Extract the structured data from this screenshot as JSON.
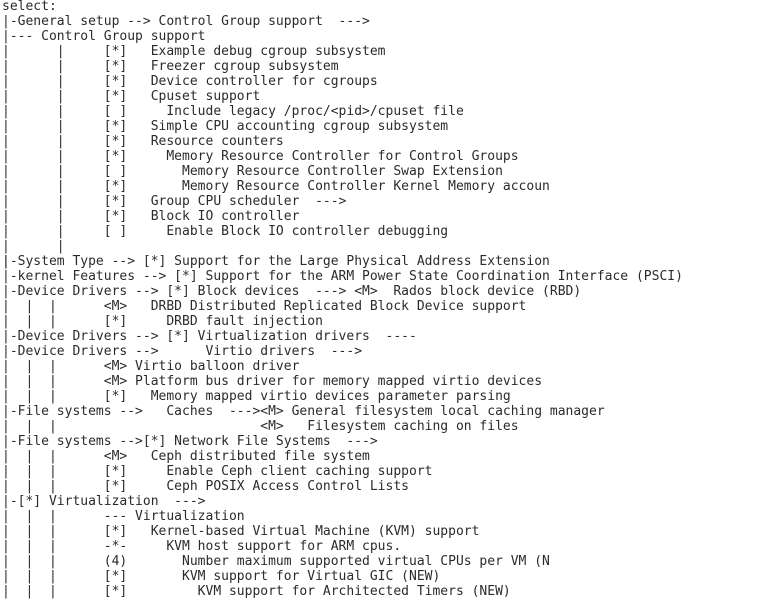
{
  "terminal": {
    "lines": [
      "select:",
      "|-General setup --> Control Group support  --->",
      "|--- Control Group support",
      "|      |     [*]   Example debug cgroup subsystem",
      "|      |     [*]   Freezer cgroup subsystem",
      "|      |     [*]   Device controller for cgroups",
      "|      |     [*]   Cpuset support",
      "|      |     [ ]     Include legacy /proc/<pid>/cpuset file",
      "|      |     [*]   Simple CPU accounting cgroup subsystem",
      "|      |     [*]   Resource counters",
      "|      |     [*]     Memory Resource Controller for Control Groups",
      "|      |     [ ]       Memory Resource Controller Swap Extension",
      "|      |     [*]       Memory Resource Controller Kernel Memory accoun",
      "|      |     [*]   Group CPU scheduler  --->",
      "|      |     [*]   Block IO controller",
      "|      |     [ ]     Enable Block IO controller debugging",
      "|      |",
      "|",
      "|-System Type --> [*] Support for the Large Physical Address Extension",
      "|-kernel Features --> [*] Support for the ARM Power State Coordination Interface (PSCI)",
      "|-Device Drivers --> [*] Block devices  ---> <M>  Rados block device (RBD)",
      "|  |  |      <M>   DRBD Distributed Replicated Block Device support",
      "|  |  |      [*]     DRBD fault injection",
      "|-Device Drivers --> [*] Virtualization drivers  ----",
      "|-Device Drivers -->      Virtio drivers  --->",
      "|  |  |      <M> Virtio balloon driver",
      "|  |  |      <M> Platform bus driver for memory mapped virtio devices",
      "|  |  |      [*]   Memory mapped virtio devices parameter parsing",
      "|-File systems -->   Caches  ---><M> General filesystem local caching manager",
      "|  |  |                          <M>   Filesystem caching on files",
      "|-File systems -->[*] Network File Systems  --->",
      "|  |  |      <M>   Ceph distributed file system",
      "|  |  |      [*]     Enable Ceph client caching support",
      "|  |  |      [*]     Ceph POSIX Access Control Lists",
      "|-[*] Virtualization  --->",
      "|  |  |      --- Virtualization",
      "|  |  |      [*]   Kernel-based Virtual Machine (KVM) support",
      "|  |  |      -*-     KVM host support for ARM cpus.",
      "|  |  |      (4)       Number maximum supported virtual CPUs per VM (N",
      "|  |  |      [*]       KVM support for Virtual GIC (NEW)",
      "|  |  |      [*]         KVM support for Architected Timers (NEW)"
    ]
  }
}
